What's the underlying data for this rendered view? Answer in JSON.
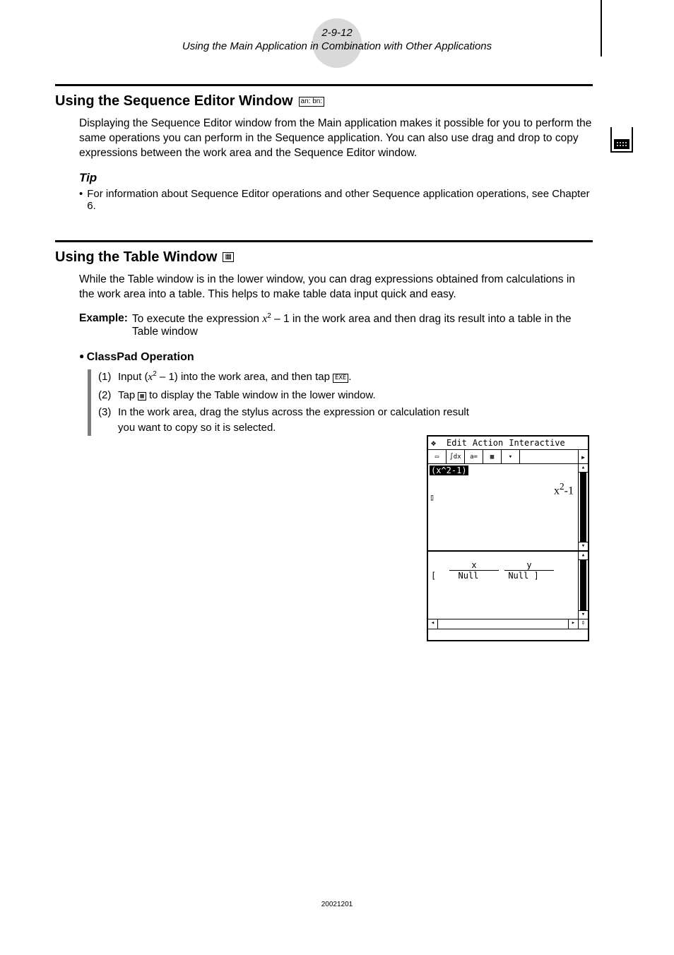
{
  "header": {
    "page_number": "2-9-12",
    "subtitle": "Using the Main Application in Combination with Other Applications"
  },
  "section_seq": {
    "heading": "Using the Sequence Editor Window",
    "icon_label": "an:\nbn:",
    "body": "Displaying the Sequence Editor window from the Main application makes it possible for you to perform the same operations you can perform in the Sequence application. You can also use drag and drop to copy expressions between the work area and the Sequence Editor window.",
    "tip_heading": "Tip",
    "tip_text": "For information about Sequence Editor operations and other Sequence application operations, see Chapter 6."
  },
  "section_table": {
    "heading": "Using the Table Window",
    "icon_label": "▦",
    "body": "While the Table window is in the lower window, you can drag expressions obtained from calculations in the work area into a table. This helps to make table data input quick and easy.",
    "example_label": "Example:",
    "example_text_prefix": "To execute the expression ",
    "example_var": "x",
    "example_sup": "2",
    "example_text_mid": " – 1 in the work area and then drag its result into a table in the Table window",
    "op_heading": "ClassPad Operation",
    "steps": [
      {
        "num": "(1)",
        "prefix": "Input (",
        "var": "x",
        "sup": "2",
        "mid": " – 1) into the work area, and then tap ",
        "icon": "EXE",
        "suffix": "."
      },
      {
        "num": "(2)",
        "prefix": "Tap ",
        "icon": "▦",
        "suffix": " to display the Table window in the lower window."
      },
      {
        "num": "(3)",
        "prefix": "In the work area, drag the stylus across the expression or calculation result you want to copy so it is selected.",
        "icon": "",
        "suffix": ""
      }
    ]
  },
  "device": {
    "menu": {
      "app": "❖",
      "items": [
        "Edit",
        "Action",
        "Interactive"
      ]
    },
    "toolbar_arrow": "▸",
    "work": {
      "selected_expr": "(x^2-1)",
      "result_var": "x",
      "result_sup": "2",
      "result_suffix": "-1",
      "cursor": "▯"
    },
    "table": {
      "headers": [
        "x",
        "y"
      ],
      "row_label": "[",
      "cells": [
        "Null",
        "Null"
      ]
    },
    "scroll": {
      "up": "▴",
      "down": "▾",
      "left": "◂",
      "right": "▸",
      "resize": "⇕"
    }
  },
  "footer": "20021201"
}
